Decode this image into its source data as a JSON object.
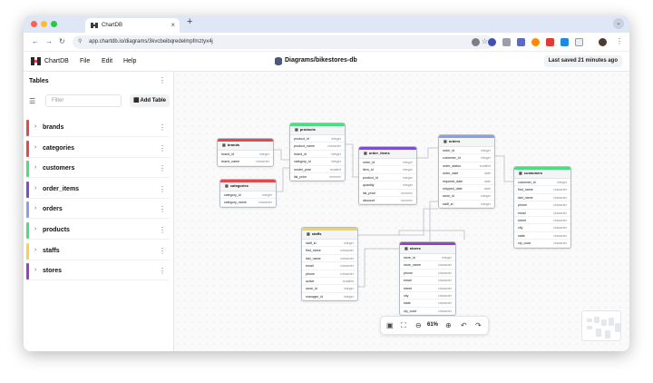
{
  "browser": {
    "tab_title": "ChartDB",
    "tab_close": "×",
    "new_tab": "+",
    "tab_menu": "⌄",
    "url": "app.chartdb.io/diagrams/3kvcbeibqredelmpfmztyx4j",
    "icons": [
      "back-icon",
      "forward-icon",
      "reload-icon",
      "star-icon",
      "extensions-icon",
      "profile-icon"
    ]
  },
  "app": {
    "name": "ChartDB",
    "menus": [
      "File",
      "Edit",
      "Help"
    ],
    "diagram_title": "Diagrams/bikestores-db",
    "last_saved": "Last saved 21 minutes ago"
  },
  "sidebar": {
    "title": "Tables",
    "filter_placeholder": "Filter",
    "add_table_label": "Add Table",
    "tables": [
      {
        "name": "brands",
        "color": "#e5484d"
      },
      {
        "name": "categories",
        "color": "#e5484d"
      },
      {
        "name": "customers",
        "color": "#4ade80"
      },
      {
        "name": "order_items",
        "color": "#7c4dcc"
      },
      {
        "name": "orders",
        "color": "#8aa0e6"
      },
      {
        "name": "products",
        "color": "#4ade80"
      },
      {
        "name": "staffs",
        "color": "#f5d547"
      },
      {
        "name": "stores",
        "color": "#9b3fc8"
      }
    ]
  },
  "canvas": {
    "nodes": [
      {
        "name": "brands",
        "color": "#e5484d",
        "fields": [
          [
            "brand_id",
            "integer"
          ],
          [
            "brand_name",
            "character"
          ]
        ]
      },
      {
        "name": "categories",
        "color": "#e5484d",
        "fields": [
          [
            "category_id",
            "integer"
          ],
          [
            "category_name",
            "character"
          ]
        ]
      },
      {
        "name": "products",
        "color": "#4ade80",
        "fields": [
          [
            "product_id",
            "integer"
          ],
          [
            "product_name",
            "character"
          ],
          [
            "brand_id",
            "integer"
          ],
          [
            "category_id",
            "integer"
          ],
          [
            "model_year",
            "smallint"
          ],
          [
            "list_price",
            "numeric"
          ]
        ]
      },
      {
        "name": "order_items",
        "color": "#7c4dcc",
        "fields": [
          [
            "order_id",
            "integer"
          ],
          [
            "item_id",
            "integer"
          ],
          [
            "product_id",
            "integer"
          ],
          [
            "quantity",
            "integer"
          ],
          [
            "list_price",
            "numeric"
          ],
          [
            "discount",
            "numeric"
          ]
        ]
      },
      {
        "name": "orders",
        "color": "#8aa0e6",
        "fields": [
          [
            "order_id",
            "integer"
          ],
          [
            "customer_id",
            "integer"
          ],
          [
            "order_status",
            "smallint"
          ],
          [
            "order_date",
            "date"
          ],
          [
            "required_date",
            "date"
          ],
          [
            "shipped_date",
            "date"
          ],
          [
            "store_id",
            "integer"
          ],
          [
            "staff_id",
            "integer"
          ]
        ]
      },
      {
        "name": "customers",
        "color": "#4ade80",
        "fields": [
          [
            "customer_id",
            "integer"
          ],
          [
            "first_name",
            "character"
          ],
          [
            "last_name",
            "character"
          ],
          [
            "phone",
            "character"
          ],
          [
            "email",
            "character"
          ],
          [
            "street",
            "character"
          ],
          [
            "city",
            "character"
          ],
          [
            "state",
            "character"
          ],
          [
            "zip_code",
            "character"
          ]
        ]
      },
      {
        "name": "staffs",
        "color": "#f5d547",
        "fields": [
          [
            "staff_id",
            "integer"
          ],
          [
            "first_name",
            "character"
          ],
          [
            "last_name",
            "character"
          ],
          [
            "email",
            "character"
          ],
          [
            "phone",
            "character"
          ],
          [
            "active",
            "smallint"
          ],
          [
            "store_id",
            "integer"
          ],
          [
            "manager_id",
            "integer"
          ]
        ]
      },
      {
        "name": "stores",
        "color": "#9b3fc8",
        "fields": [
          [
            "store_id",
            "integer"
          ],
          [
            "store_name",
            "character"
          ],
          [
            "phone",
            "character"
          ],
          [
            "email",
            "character"
          ],
          [
            "street",
            "character"
          ],
          [
            "city",
            "character"
          ],
          [
            "state",
            "character"
          ],
          [
            "zip_code",
            "character"
          ]
        ]
      }
    ],
    "zoom": "61%"
  }
}
